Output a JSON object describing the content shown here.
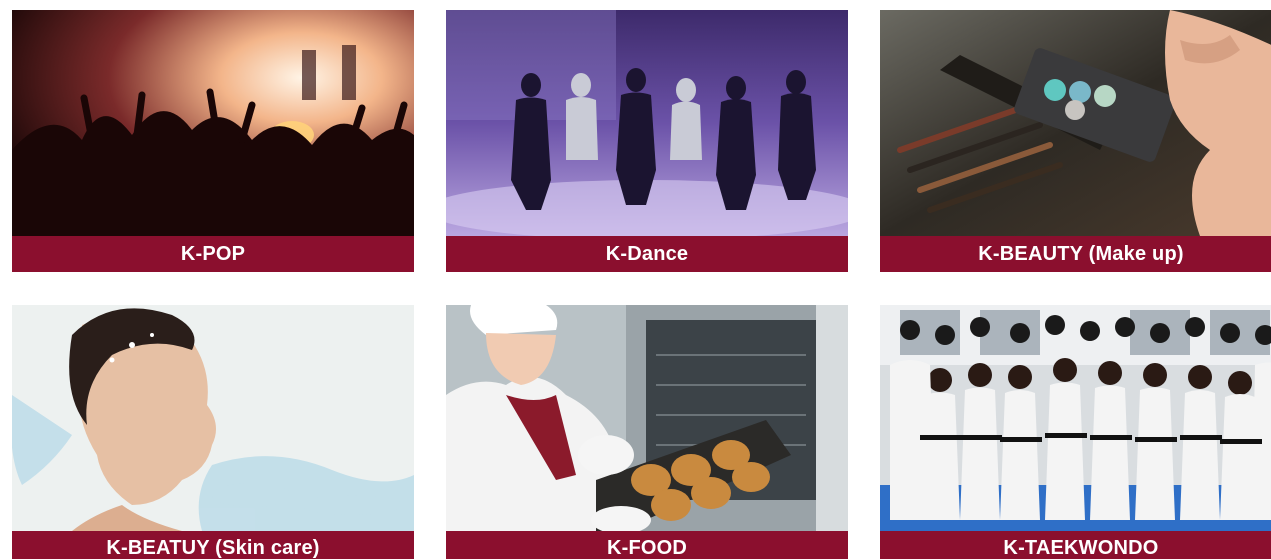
{
  "theme": {
    "caption_bg": "#8b0f2e",
    "caption_text": "#ffffff"
  },
  "cards": [
    {
      "label": "K-POP"
    },
    {
      "label": "K-Dance"
    },
    {
      "label": "K-BEAUTY (Make up)"
    },
    {
      "label": "K-BEATUY (Skin care)"
    },
    {
      "label": "K-FOOD"
    },
    {
      "label": "K-TAEKWONDO"
    }
  ]
}
